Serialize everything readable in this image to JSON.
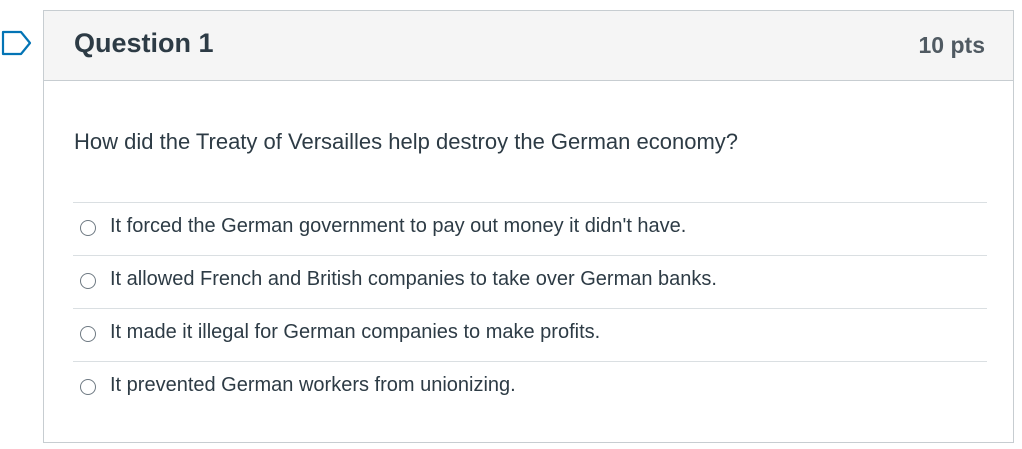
{
  "question": {
    "title": "Question 1",
    "points": "10 pts",
    "text": "How did the Treaty of Versailles help destroy the German economy?",
    "flag_icon": "bookmark-flag-icon"
  },
  "answers": [
    {
      "label": "It forced the German government to pay out money it didn't have.",
      "selected": false
    },
    {
      "label": "It allowed French and British companies to take over German banks.",
      "selected": false
    },
    {
      "label": "It made it illegal for German companies to make profits.",
      "selected": false
    },
    {
      "label": "It prevented German workers from unionizing.",
      "selected": false
    }
  ],
  "colors": {
    "text": "#2d3b45",
    "header_bg": "#f5f5f5",
    "border": "#c7cdd1",
    "flag_stroke": "#0374b5"
  }
}
